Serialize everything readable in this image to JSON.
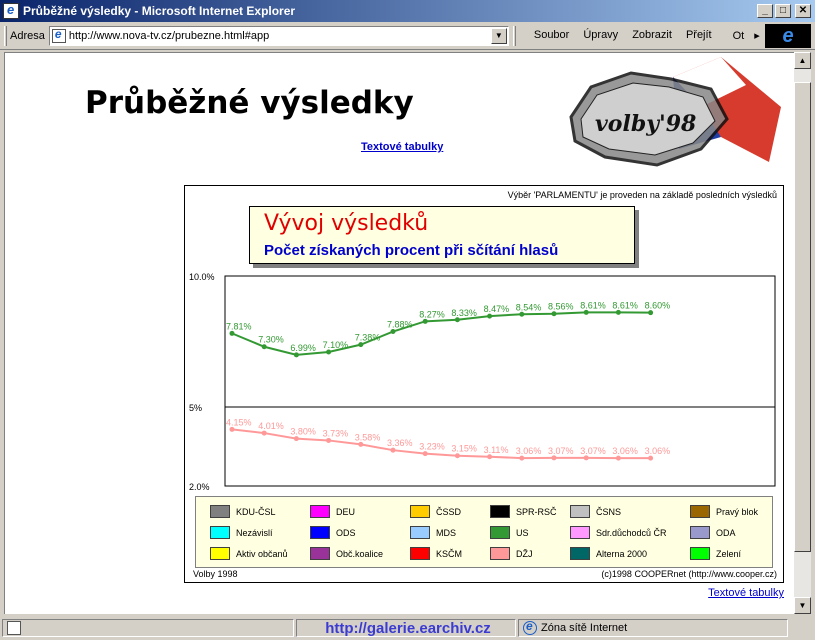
{
  "window": {
    "title": "Průběžné výsledky - Microsoft Internet Explorer"
  },
  "toolbar": {
    "address_label": "Adresa",
    "url": "http://www.nova-tv.cz/prubezne.html#app",
    "menu": [
      "Soubor",
      "Úpravy",
      "Zobrazit",
      "Přejít",
      "Ot"
    ]
  },
  "page": {
    "title": "Průběžné výsledky",
    "logo_text": "volby'98",
    "top_link": "Textové tabulky",
    "bottom_link": "Textové tabulky"
  },
  "panel": {
    "note": "Výběr 'PARLAMENTU' je proveden na základě posledních výsledků",
    "heading": "Vývoj výsledků",
    "subheading": "Počet získaných procent při sčítání hlasů",
    "footer_left": "Volby 1998",
    "footer_right": "(c)1998 COOPERnet (http://www.cooper.cz)"
  },
  "chart_data": {
    "type": "line",
    "y_ticks": [
      "10.0%",
      "5%",
      "2.0%"
    ],
    "series": [
      {
        "name": "US",
        "color": "#339933",
        "values": [
          7.81,
          7.3,
          6.99,
          7.1,
          7.38,
          7.88,
          8.27,
          8.33,
          8.47,
          8.54,
          8.56,
          8.61,
          8.61,
          8.6
        ],
        "labels": [
          "7.81%",
          "7.30%",
          "6.99%",
          "7.10%",
          "7.38%",
          "7.88%",
          "8.27%",
          "8.33%",
          "8.47%",
          "8.54%",
          "8.56%",
          "8.61%",
          "8.61%",
          "8.60%"
        ]
      },
      {
        "name": "DŽJ",
        "color": "#ff9999",
        "values": [
          4.15,
          4.01,
          3.8,
          3.73,
          3.58,
          3.36,
          3.23,
          3.15,
          3.11,
          3.06,
          3.07,
          3.07,
          3.06,
          3.06
        ],
        "labels": [
          "4.15%",
          "4.01%",
          "3.80%",
          "3.73%",
          "3.58%",
          "3.36%",
          "3.23%",
          "3.15%",
          "3.11%",
          "3.06%",
          "3.07%",
          "3.07%",
          "3.06%",
          "3.06%"
        ]
      }
    ]
  },
  "legend": [
    {
      "label": "KDU-ČSL",
      "color": "#808080"
    },
    {
      "label": "DEU",
      "color": "#ff00ff"
    },
    {
      "label": "ČSSD",
      "color": "#ffcc00"
    },
    {
      "label": "SPR-RSČ",
      "color": "#000000"
    },
    {
      "label": "ČSNS",
      "color": "#c0c0c0"
    },
    {
      "label": "Pravý blok",
      "color": "#996600"
    },
    {
      "label": "Nezávislí",
      "color": "#00ffff"
    },
    {
      "label": "ODS",
      "color": "#0000ff"
    },
    {
      "label": "MDS",
      "color": "#99ccff"
    },
    {
      "label": "US",
      "color": "#339933"
    },
    {
      "label": "Sdr.důchodců ČR",
      "color": "#ff99ff"
    },
    {
      "label": "ODA",
      "color": "#9999cc"
    },
    {
      "label": "Aktiv občanů",
      "color": "#ffff00"
    },
    {
      "label": "Obč.koalice",
      "color": "#993399"
    },
    {
      "label": "KSČM",
      "color": "#ff0000"
    },
    {
      "label": "DŽJ",
      "color": "#ff9999"
    },
    {
      "label": "Alterna 2000",
      "color": "#006666"
    },
    {
      "label": "Zelení",
      "color": "#00ff00"
    }
  ],
  "status": {
    "url": "http://galerie.earchiv.cz",
    "zone": "Zóna sítě Internet"
  }
}
